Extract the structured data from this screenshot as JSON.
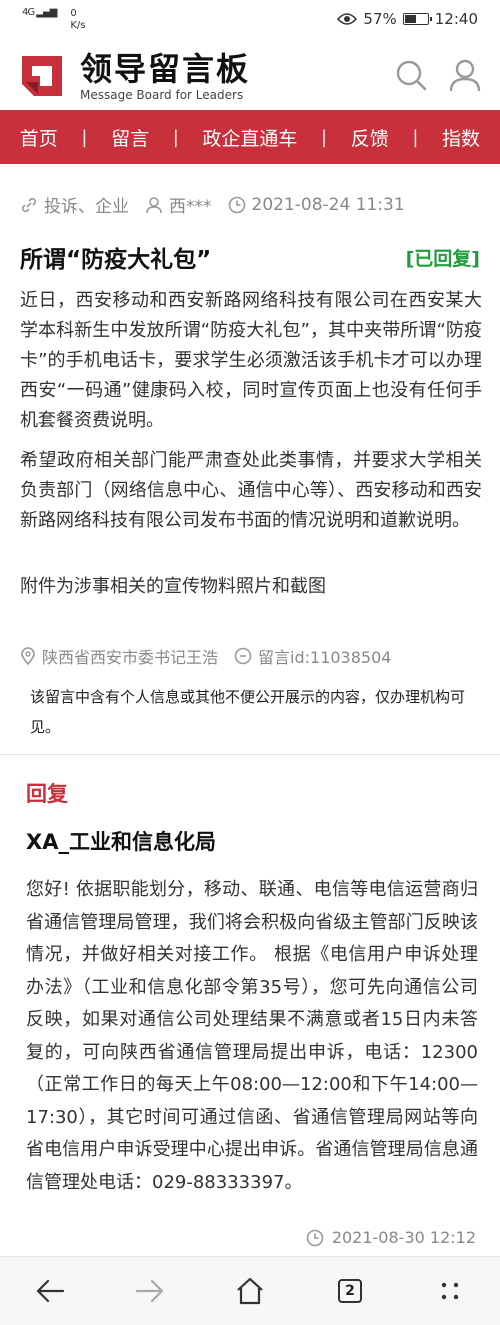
{
  "status": {
    "signal": "4G",
    "net_value": "0",
    "net_unit": "K/s",
    "battery": "57%",
    "battery_level": 0.57,
    "time": "12:40"
  },
  "header": {
    "title": "领导留言板",
    "subtitle": "Message Board for Leaders"
  },
  "nav": {
    "items": [
      "首页",
      "留言",
      "政企直通车",
      "反馈",
      "指数"
    ]
  },
  "message": {
    "category": "投诉、企业",
    "user": "西***",
    "datetime": "2021-08-24 11:31",
    "title": "所谓“防疫大礼包”",
    "status": "[已回复]",
    "paragraphs": [
      "近日，西安移动和西安新路网络科技有限公司在西安某大学本科新生中发放所谓“防疫大礼包”，其中夹带所谓“防疫卡”的手机电话卡，要求学生必须激活该手机卡才可以办理西安“一码通”健康码入校，同时宣传页面上也没有任何手机套餐资费说明。",
      "希望政府相关部门能严肃查处此类事情，并要求大学相关负责部门（网络信息中心、通信中心等）、西安移动和西安新路网络科技有限公司发布书面的情况说明和道歉说明。",
      "附件为涉事相关的宣传物料照片和截图"
    ],
    "recipient": "陕西省西安市委书记王浩",
    "message_id": "留言id:11038504",
    "notice": "该留言中含有个人信息或其他不便公开展示的内容，仅办理机构可见。"
  },
  "reply": {
    "label": "回复",
    "department": "XA_工业和信息化局",
    "text": "您好! 依据职能划分，移动、联通、电信等电信运营商归省通信管理局管理，我们将会积极向省级主管部门反映该情况，并做好相关对接工作。 根据《电信用户申诉处理办法》（工业和信息化部令第35号），您可先向通信公司反映，如果对通信公司处理结果不满意或者15日内未答复的，可向陕西省通信管理局提出申诉，电话：12300（正常工作日的每天上午08:00—12:00和下午14:00—17:30），其它时间可通过信函、省通信管理局网站等向省电信用户申诉受理中心提出申诉。省通信管理局信息通信管理处电话：029-88333397。",
    "datetime": "2021-08-30 12:12"
  },
  "browser": {
    "tab_count": "2"
  },
  "colors": {
    "brand_red": "#c8303c",
    "replied_green": "#1e9b3d"
  }
}
